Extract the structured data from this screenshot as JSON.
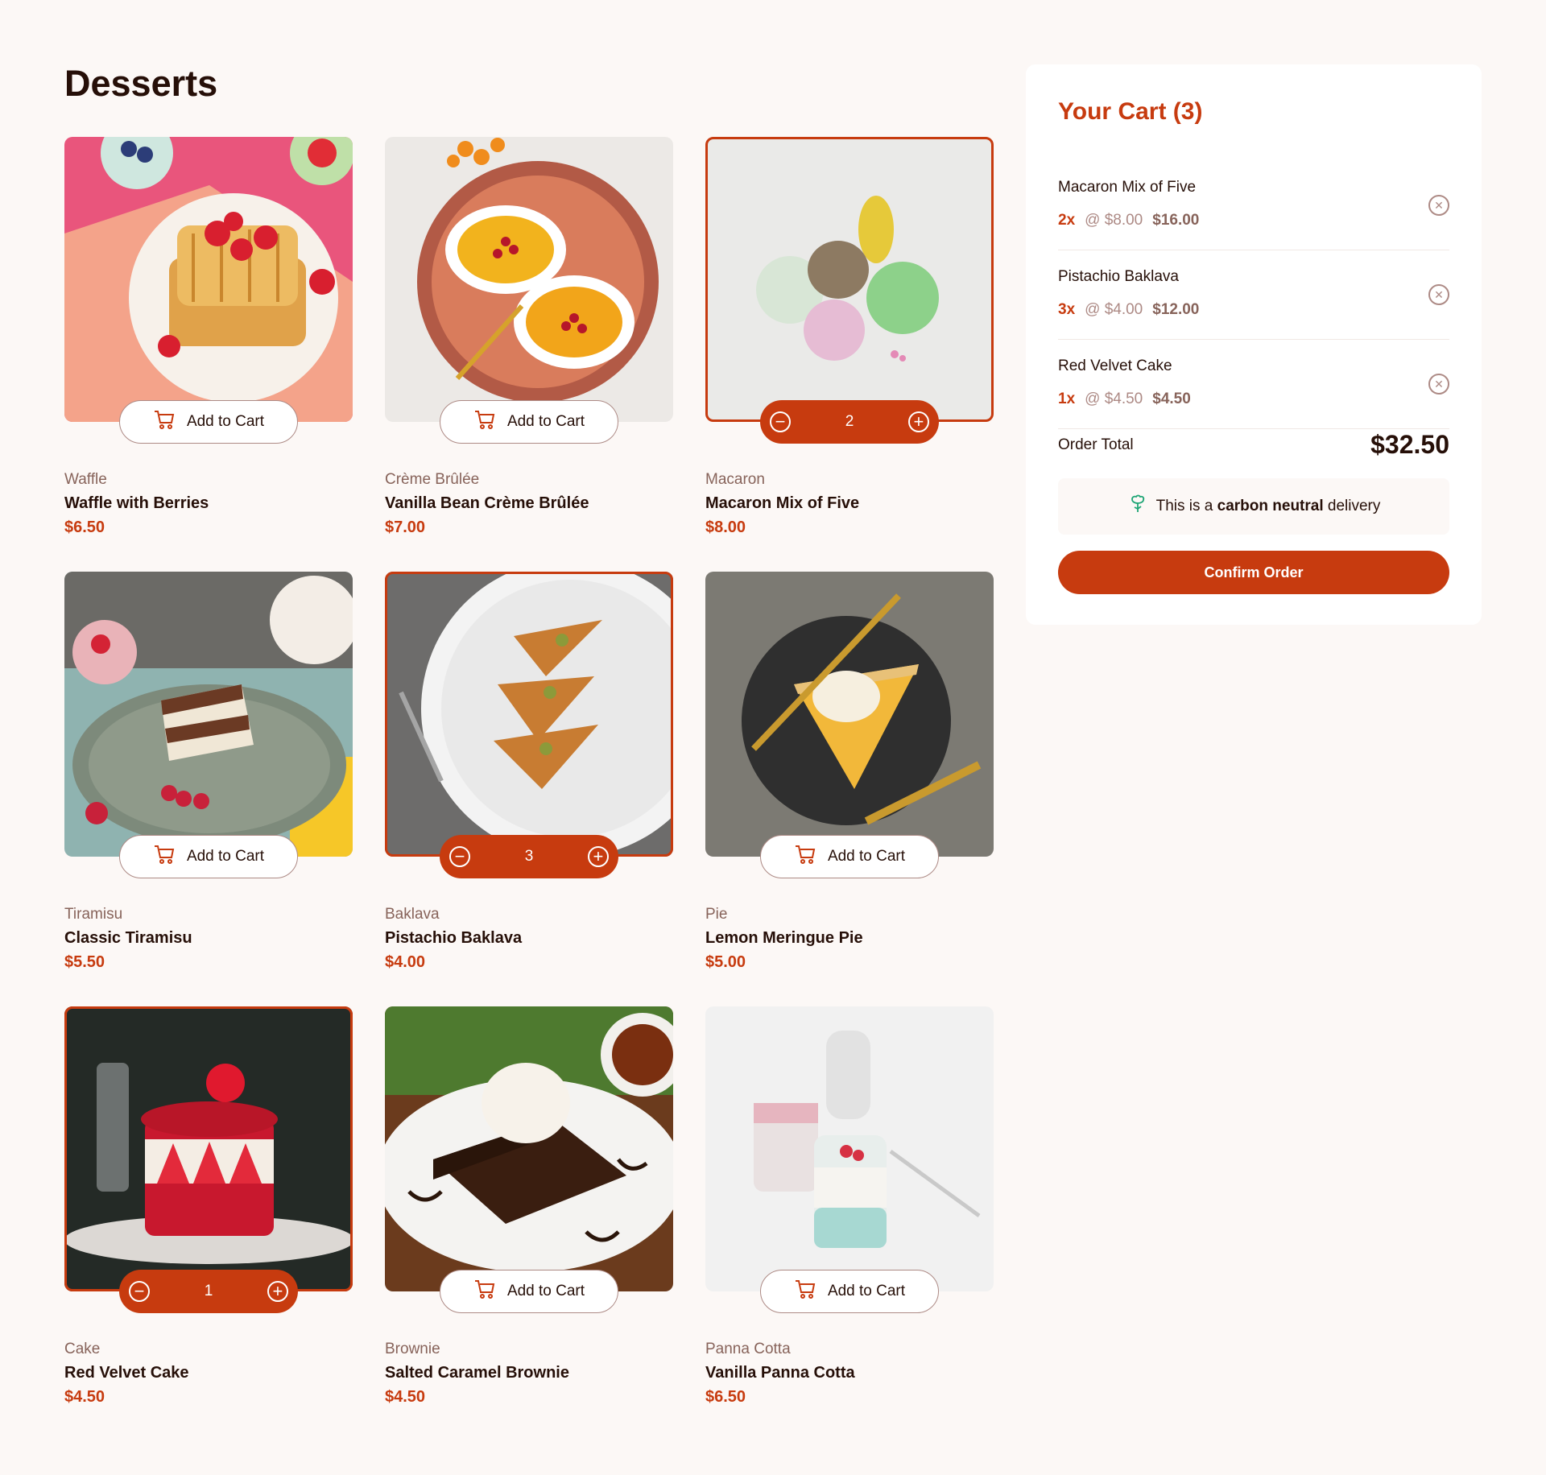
{
  "page": {
    "title": "Desserts"
  },
  "products": [
    {
      "category": "Waffle",
      "name": "Waffle with Berries",
      "price": "$6.50",
      "in_cart": false,
      "button_label": "Add to Cart",
      "image": "waffle"
    },
    {
      "category": "Crème Brûlée",
      "name": "Vanilla Bean Crème Brûlée",
      "price": "$7.00",
      "in_cart": false,
      "button_label": "Add to Cart",
      "image": "creme-brulee"
    },
    {
      "category": "Macaron",
      "name": "Macaron Mix of Five",
      "price": "$8.00",
      "in_cart": true,
      "quantity": "2",
      "image": "macaron"
    },
    {
      "category": "Tiramisu",
      "name": "Classic Tiramisu",
      "price": "$5.50",
      "in_cart": false,
      "button_label": "Add to Cart",
      "image": "tiramisu"
    },
    {
      "category": "Baklava",
      "name": "Pistachio Baklava",
      "price": "$4.00",
      "in_cart": true,
      "quantity": "3",
      "image": "baklava"
    },
    {
      "category": "Pie",
      "name": "Lemon Meringue Pie",
      "price": "$5.00",
      "in_cart": false,
      "button_label": "Add to Cart",
      "image": "pie"
    },
    {
      "category": "Cake",
      "name": "Red Velvet Cake",
      "price": "$4.50",
      "in_cart": true,
      "quantity": "1",
      "image": "cake"
    },
    {
      "category": "Brownie",
      "name": "Salted Caramel Brownie",
      "price": "$4.50",
      "in_cart": false,
      "button_label": "Add to Cart",
      "image": "brownie"
    },
    {
      "category": "Panna Cotta",
      "name": "Vanilla Panna Cotta",
      "price": "$6.50",
      "in_cart": false,
      "button_label": "Add to Cart",
      "image": "panna-cotta"
    }
  ],
  "cart": {
    "title": "Your Cart (3)",
    "items": [
      {
        "name": "Macaron Mix of Five",
        "qty": "2x",
        "unit": "@ $8.00",
        "subtotal": "$16.00"
      },
      {
        "name": "Pistachio Baklava",
        "qty": "3x",
        "unit": "@ $4.00",
        "subtotal": "$12.00"
      },
      {
        "name": "Red Velvet Cake",
        "qty": "1x",
        "unit": "@ $4.50",
        "subtotal": "$4.50"
      }
    ],
    "total_label": "Order Total",
    "total_value": "$32.50",
    "carbon": {
      "prefix": "This is a",
      "bold": "carbon neutral",
      "suffix": "delivery"
    },
    "confirm_label": "Confirm Order"
  },
  "colors": {
    "accent": "#c73b0f",
    "background": "#fcf8f6",
    "text": "#260f08",
    "muted": "#87635a",
    "border": "#ad8a85",
    "carbon_icon": "#1ea575"
  },
  "icons": [
    "cart-icon",
    "decrement-icon",
    "increment-icon",
    "remove-icon",
    "carbon-neutral-icon"
  ]
}
